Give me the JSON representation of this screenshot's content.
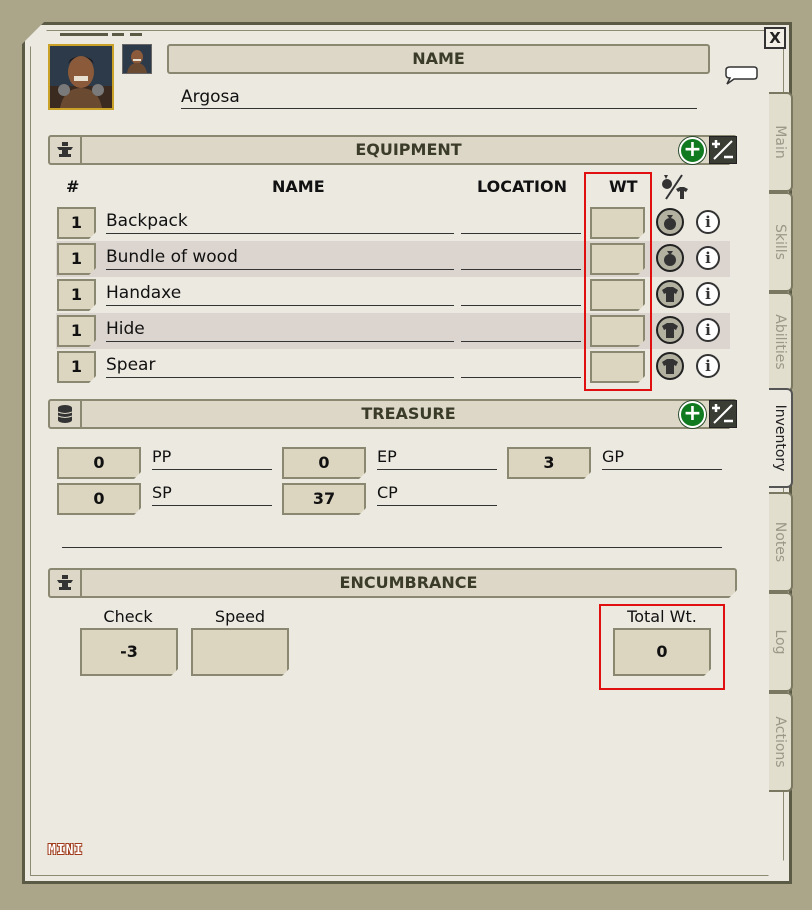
{
  "window": {
    "close_label": "X"
  },
  "header": {
    "name_title": "NAME",
    "character_name": "Argosa"
  },
  "equipment": {
    "title": "EQUIPMENT",
    "columns": {
      "count": "#",
      "name": "NAME",
      "location": "LOCATION",
      "weight": "WT"
    },
    "items": [
      {
        "qty": "1",
        "name": "Backpack",
        "location": "",
        "weight": "",
        "type_icon": "bag-icon"
      },
      {
        "qty": "1",
        "name": "Bundle of wood",
        "location": "",
        "weight": "",
        "type_icon": "bag-icon"
      },
      {
        "qty": "1",
        "name": "Handaxe",
        "location": "",
        "weight": "",
        "type_icon": "shirt-icon"
      },
      {
        "qty": "1",
        "name": "Hide",
        "location": "",
        "weight": "",
        "type_icon": "shirt-icon"
      },
      {
        "qty": "1",
        "name": "Spear",
        "location": "",
        "weight": "",
        "type_icon": "shirt-icon"
      }
    ]
  },
  "treasure": {
    "title": "TREASURE",
    "coins": [
      {
        "value": "0",
        "label": "PP"
      },
      {
        "value": "0",
        "label": "EP"
      },
      {
        "value": "3",
        "label": "GP"
      },
      {
        "value": "0",
        "label": "SP"
      },
      {
        "value": "37",
        "label": "CP"
      }
    ]
  },
  "encumbrance": {
    "title": "ENCUMBRANCE",
    "check_label": "Check",
    "check_value": "-3",
    "speed_label": "Speed",
    "speed_value": "",
    "total_label": "Total Wt.",
    "total_value": "0"
  },
  "tabs": [
    "Main",
    "Skills",
    "Abilities",
    "Inventory",
    "Notes",
    "Log",
    "Actions"
  ],
  "active_tab": "Inventory",
  "footer": {
    "mini_label": "MINI"
  },
  "colors": {
    "highlight": "#e01010",
    "add_button": "#0f7a1f",
    "panel": "#ece9e1",
    "frame": "#aba58a"
  }
}
